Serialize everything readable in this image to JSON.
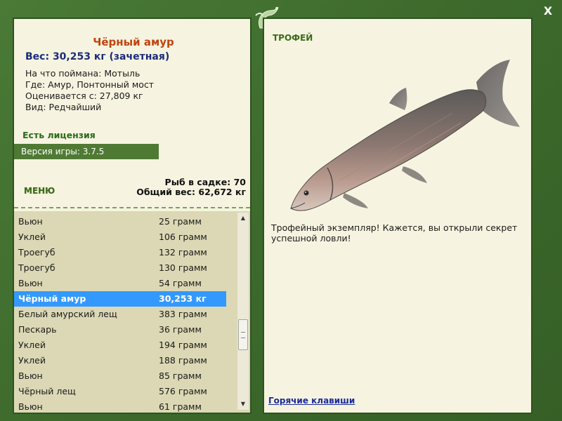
{
  "window": {
    "close_label": "X"
  },
  "fish": {
    "title": "Чёрный амур",
    "weight_line": "Вес: 30,253 кг (зачетная)",
    "caught_on": "На что поймана: Мотыль",
    "where": "Где: Амур, Понтонный мост",
    "valued_from": "Оценивается с: 27,809 кг",
    "kind": "Вид: Редчайший"
  },
  "license": "Есть лицензия",
  "version": "Версия игры: 3.7.5",
  "menu_label": "МЕНЮ",
  "stats": {
    "count": "Рыб в садке: 70",
    "total": "Общий вес: 62,672 кг"
  },
  "catch_list": [
    {
      "name": "Вьюн",
      "weight": "25 грамм"
    },
    {
      "name": "Уклей",
      "weight": "106 грамм"
    },
    {
      "name": "Троегуб",
      "weight": "132 грамм"
    },
    {
      "name": "Троегуб",
      "weight": "130 грамм"
    },
    {
      "name": "Вьюн",
      "weight": "54 грамм"
    },
    {
      "name": "Чёрный амур",
      "weight": "30,253 кг"
    },
    {
      "name": "Белый амурский лещ",
      "weight": "383 грамм"
    },
    {
      "name": "Пескарь",
      "weight": "36 грамм"
    },
    {
      "name": "Уклей",
      "weight": "194 грамм"
    },
    {
      "name": "Уклей",
      "weight": "188 грамм"
    },
    {
      "name": "Вьюн",
      "weight": "85 грамм"
    },
    {
      "name": "Чёрный лещ",
      "weight": "576 грамм"
    },
    {
      "name": "Вьюн",
      "weight": "61 грамм"
    }
  ],
  "selected_index": 5,
  "trophy": {
    "label": "ТРОФЕЙ",
    "text": "Трофейный экземпляр! Кажется, вы открыли секрет успешной ловли!"
  },
  "hotkeys": "Горячие клавиши",
  "colors": {
    "frame_green": "#3f6e2f",
    "panel_bg": "#f6f4e0",
    "title_orange": "#c0440f",
    "selected_blue": "#3399ff"
  }
}
